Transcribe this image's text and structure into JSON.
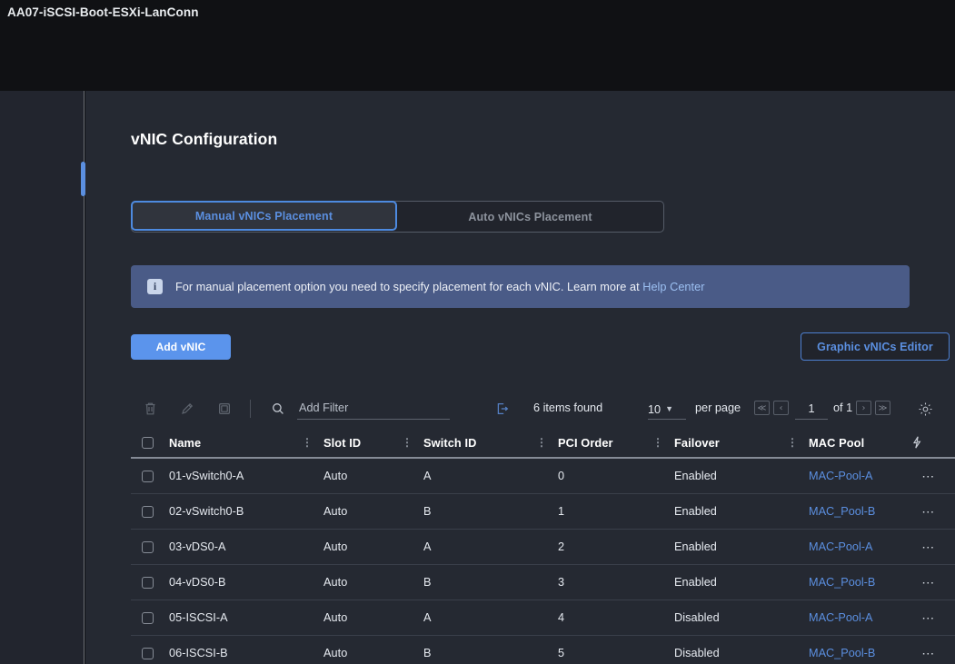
{
  "window": {
    "breadcrumb_title": "AA07-iSCSI-Boot-ESXi-LanConn"
  },
  "page": {
    "title": "vNIC Configuration"
  },
  "tabs": [
    {
      "label": "Manual vNICs Placement",
      "active": true
    },
    {
      "label": "Auto vNICs Placement",
      "active": false
    }
  ],
  "info_banner": {
    "icon": "info-icon",
    "text": "For manual placement option you need to specify placement for each vNIC. Learn more at ",
    "link_label": "Help Center",
    "background": "#4a5b87"
  },
  "actions": {
    "add_vnic_label": "Add vNIC",
    "graphic_editor_label": "Graphic vNICs Editor",
    "primary_color": "#5b94ec",
    "link_color": "#5b8fe0"
  },
  "toolbar": {
    "delete_icon": "trash-icon",
    "edit_icon": "pencil-icon",
    "clone_icon": "clone-icon",
    "search_icon": "search-icon",
    "filter_placeholder": "Add Filter",
    "filter_value": "",
    "export_icon": "export-icon",
    "items_found": "6 items found",
    "per_page_value": "10",
    "per_page_label": "per page",
    "page_current": "1",
    "page_of": "of 1",
    "first_page_icon": "≪",
    "prev_page_icon": "‹",
    "next_page_icon": "›",
    "last_page_icon": "≫",
    "settings_icon": "gear-icon"
  },
  "table": {
    "columns": [
      "Name",
      "Slot ID",
      "Switch ID",
      "PCI Order",
      "Failover",
      "MAC Pool"
    ],
    "trailing_icon": "lightning-bolt-icon",
    "row_menu_icon": "ellipsis-icon",
    "rows": [
      {
        "name": "01-vSwitch0-A",
        "slot_id": "Auto",
        "switch_id": "A",
        "pci_order": "0",
        "failover": "Enabled",
        "mac_pool": "MAC-Pool-A"
      },
      {
        "name": "02-vSwitch0-B",
        "slot_id": "Auto",
        "switch_id": "B",
        "pci_order": "1",
        "failover": "Enabled",
        "mac_pool": "MAC_Pool-B"
      },
      {
        "name": "03-vDS0-A",
        "slot_id": "Auto",
        "switch_id": "A",
        "pci_order": "2",
        "failover": "Enabled",
        "mac_pool": "MAC-Pool-A"
      },
      {
        "name": "04-vDS0-B",
        "slot_id": "Auto",
        "switch_id": "B",
        "pci_order": "3",
        "failover": "Enabled",
        "mac_pool": "MAC_Pool-B"
      },
      {
        "name": "05-ISCSI-A",
        "slot_id": "Auto",
        "switch_id": "A",
        "pci_order": "4",
        "failover": "Disabled",
        "mac_pool": "MAC-Pool-A"
      },
      {
        "name": "06-ISCSI-B",
        "slot_id": "Auto",
        "switch_id": "B",
        "pci_order": "5",
        "failover": "Disabled",
        "mac_pool": "MAC_Pool-B"
      }
    ]
  }
}
